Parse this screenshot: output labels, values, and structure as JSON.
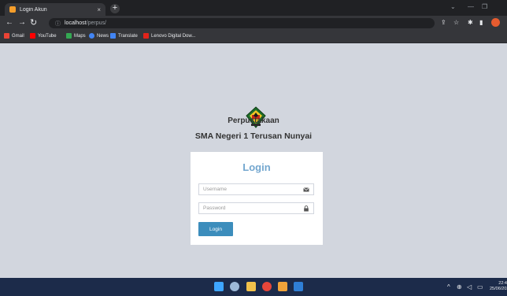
{
  "browser": {
    "tab_title": "Login Akun",
    "tab_close": "×",
    "new_tab": "+",
    "url_host": "localhost",
    "url_path": "/perpus/",
    "url_info_icon": "ⓘ",
    "bookmarks": [
      {
        "label": "Gmail",
        "icon": "gmail-icon",
        "color": "#ea4335"
      },
      {
        "label": "YouTube",
        "icon": "youtube-icon",
        "color": "#ff0000"
      },
      {
        "label": "Maps",
        "icon": "maps-icon",
        "color": "#34a853"
      },
      {
        "label": "News",
        "icon": "news-icon",
        "color": "#4285f4"
      },
      {
        "label": "Translate",
        "icon": "translate-icon",
        "color": "#4285f4"
      },
      {
        "label": "Lenovo Digital Dow...",
        "icon": "lenovo-icon",
        "color": "#e2231a"
      }
    ]
  },
  "page": {
    "app_name": "Perpustakaan",
    "school_name": "SMA Negeri 1 Terusan Nunyai"
  },
  "login": {
    "title": "Login",
    "username_placeholder": "Username",
    "password_placeholder": "Password",
    "submit_label": "Login"
  },
  "taskbar": {
    "time": "22:4",
    "date": "25/06/202"
  },
  "colors": {
    "page_bg": "#d2d6de",
    "login_title": "#74a7cf",
    "login_button": "#3c8dbc"
  }
}
